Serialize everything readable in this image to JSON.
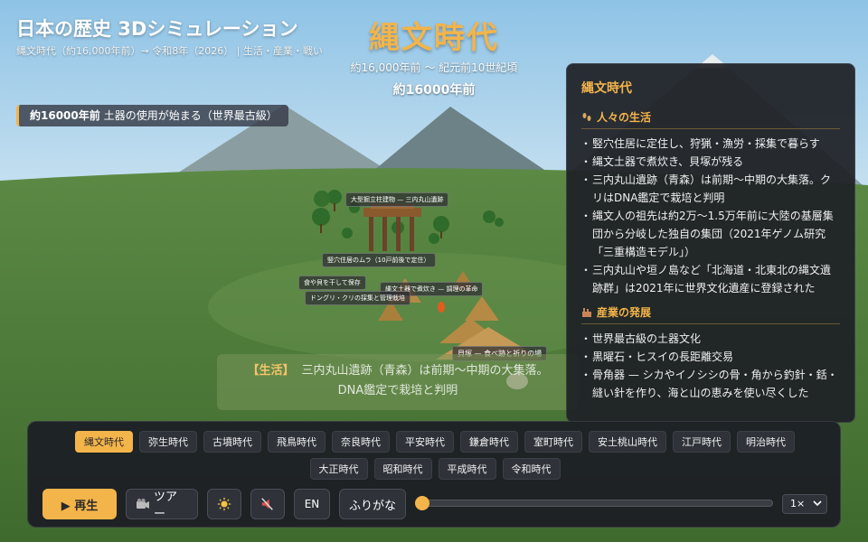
{
  "header": {
    "title": "日本の歴史 3Dシミュレーション",
    "subtitle": "縄文時代（約16,000年前）→ 令和8年（2026） | 生活・産業・戦い"
  },
  "era": {
    "name": "縄文時代",
    "range": "約16,000年前 〜 紀元前10世紀頃",
    "current_year": "約16000年前"
  },
  "event": {
    "year": "約16000年前",
    "text": "土器の使用が始まる（世界最古級）"
  },
  "scene_labels": [
    "大型掘立柱建物 — 三内丸山遺跡",
    "竪穴住居のムラ（10戸前後で定住）",
    "食や貝を干して保存",
    "縄文土器で煮炊き — 調理の革命",
    "ドングリ・クリの採集と管理栽培",
    "貝塚 — 食べ跡と祈りの場"
  ],
  "life_caption": {
    "tag": "【生活】",
    "line1": "三内丸山遺跡（青森）は前期〜中期の大集落。",
    "line2": "DNA鑑定で栽培と判明"
  },
  "info_panel": {
    "title": "縄文時代",
    "sections": [
      {
        "title": "人々の生活",
        "icon": "footprints-icon",
        "items": [
          "竪穴住居に定住し、狩猟・漁労・採集で暮らす",
          "縄文土器で煮炊き、貝塚が残る",
          "三内丸山遺跡（青森）は前期〜中期の大集落。クリはDNA鑑定で栽培と判明",
          "縄文人の祖先は約2万〜1.5万年前に大陸の基層集団から分岐した独自の集団（2021年ゲノム研究「三重構造モデル」）",
          "三内丸山や垣ノ島など「北海道・北東北の縄文遺跡群」は2021年に世界文化遺産に登録された"
        ]
      },
      {
        "title": "産業の発展",
        "icon": "factory-icon",
        "items": [
          "世界最古級の土器文化",
          "黒曜石・ヒスイの長距離交易",
          "骨角器 — シカやイノシシの骨・角から釣針・銛・縫い針を作り、海と山の恵みを使い尽くした"
        ]
      }
    ]
  },
  "eras": [
    "縄文時代",
    "弥生時代",
    "古墳時代",
    "飛鳥時代",
    "奈良時代",
    "平安時代",
    "鎌倉時代",
    "室町時代",
    "安土桃山時代",
    "江戸時代",
    "明治時代",
    "大正時代",
    "昭和時代",
    "平成時代",
    "令和時代"
  ],
  "active_era": "縄文時代",
  "controls": {
    "play_label": "▶ 再生",
    "tour_label": "ツアー",
    "tour_icon": "camera-icon",
    "light_icon": "sun-icon",
    "sound_icon": "mute-icon",
    "lang_label": "EN",
    "furigana_label": "ふりがな",
    "timeline_progress": 0.0,
    "speed_value": "1×"
  },
  "colors": {
    "accent": "#f3b44a",
    "panel_bg": "#1e2026",
    "sky": "#a9d0ea",
    "ground": "#4f7d3a"
  }
}
